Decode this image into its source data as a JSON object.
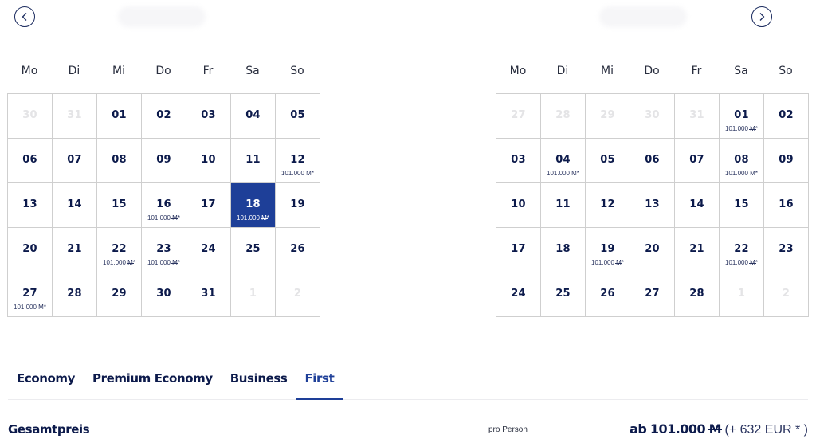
{
  "navigation": {
    "prev_icon": "chevron-left-circle-icon",
    "next_icon": "chevron-right-circle-icon"
  },
  "colors": {
    "brand_dark": "#0c1a4b",
    "accent": "#1e3f98",
    "muted_day": "#e4e4e6",
    "grid_border": "#cfcfcf"
  },
  "weekdays": [
    "Mo",
    "Di",
    "Mi",
    "Do",
    "Fr",
    "Sa",
    "So"
  ],
  "calendars": [
    {
      "days": [
        {
          "d": "30",
          "muted": true
        },
        {
          "d": "31",
          "muted": true
        },
        {
          "d": "01"
        },
        {
          "d": "02"
        },
        {
          "d": "03"
        },
        {
          "d": "04"
        },
        {
          "d": "05"
        },
        {
          "d": "06"
        },
        {
          "d": "07"
        },
        {
          "d": "08"
        },
        {
          "d": "09"
        },
        {
          "d": "10"
        },
        {
          "d": "11"
        },
        {
          "d": "12",
          "price": "101.000",
          "unit": "M",
          "suffix": "*"
        },
        {
          "d": "13"
        },
        {
          "d": "14"
        },
        {
          "d": "15"
        },
        {
          "d": "16",
          "price": "101.000",
          "unit": "M",
          "suffix": "*"
        },
        {
          "d": "17"
        },
        {
          "d": "18",
          "price": "101.000",
          "unit": "M",
          "suffix": "*",
          "selected": true
        },
        {
          "d": "19"
        },
        {
          "d": "20"
        },
        {
          "d": "21"
        },
        {
          "d": "22",
          "price": "101.000",
          "unit": "M",
          "suffix": "*"
        },
        {
          "d": "23",
          "price": "101.000",
          "unit": "M",
          "suffix": "*"
        },
        {
          "d": "24"
        },
        {
          "d": "25"
        },
        {
          "d": "26"
        },
        {
          "d": "27",
          "price": "101.000",
          "unit": "M",
          "suffix": "*"
        },
        {
          "d": "28"
        },
        {
          "d": "29"
        },
        {
          "d": "30"
        },
        {
          "d": "31"
        },
        {
          "d": "1",
          "muted": true
        },
        {
          "d": "2",
          "muted": true
        }
      ]
    },
    {
      "days": [
        {
          "d": "27",
          "muted": true
        },
        {
          "d": "28",
          "muted": true
        },
        {
          "d": "29",
          "muted": true
        },
        {
          "d": "30",
          "muted": true
        },
        {
          "d": "31",
          "muted": true
        },
        {
          "d": "01",
          "price": "101.000",
          "unit": "M",
          "suffix": "*"
        },
        {
          "d": "02"
        },
        {
          "d": "03"
        },
        {
          "d": "04",
          "price": "101.000",
          "unit": "M",
          "suffix": "*"
        },
        {
          "d": "05"
        },
        {
          "d": "06"
        },
        {
          "d": "07"
        },
        {
          "d": "08",
          "price": "101.000",
          "unit": "M",
          "suffix": "*"
        },
        {
          "d": "09"
        },
        {
          "d": "10"
        },
        {
          "d": "11"
        },
        {
          "d": "12"
        },
        {
          "d": "13"
        },
        {
          "d": "14"
        },
        {
          "d": "15"
        },
        {
          "d": "16"
        },
        {
          "d": "17"
        },
        {
          "d": "18"
        },
        {
          "d": "19",
          "price": "101.000",
          "unit": "M",
          "suffix": "*"
        },
        {
          "d": "20"
        },
        {
          "d": "21"
        },
        {
          "d": "22",
          "price": "101.000",
          "unit": "M",
          "suffix": "*"
        },
        {
          "d": "23"
        },
        {
          "d": "24"
        },
        {
          "d": "25"
        },
        {
          "d": "26"
        },
        {
          "d": "27"
        },
        {
          "d": "28"
        },
        {
          "d": "1",
          "muted": true
        },
        {
          "d": "2",
          "muted": true
        }
      ]
    }
  ],
  "tabs": [
    {
      "label": "Economy",
      "active": false
    },
    {
      "label": "Premium Economy",
      "active": false
    },
    {
      "label": "Business",
      "active": false
    },
    {
      "label": "First",
      "active": true
    }
  ],
  "summary": {
    "total_label": "Gesamtpreis",
    "per_person": "pro Person",
    "price_prefix": "ab",
    "price_amount": "101.000",
    "price_unit": "M",
    "price_extra": "(+ 632 EUR * )"
  }
}
